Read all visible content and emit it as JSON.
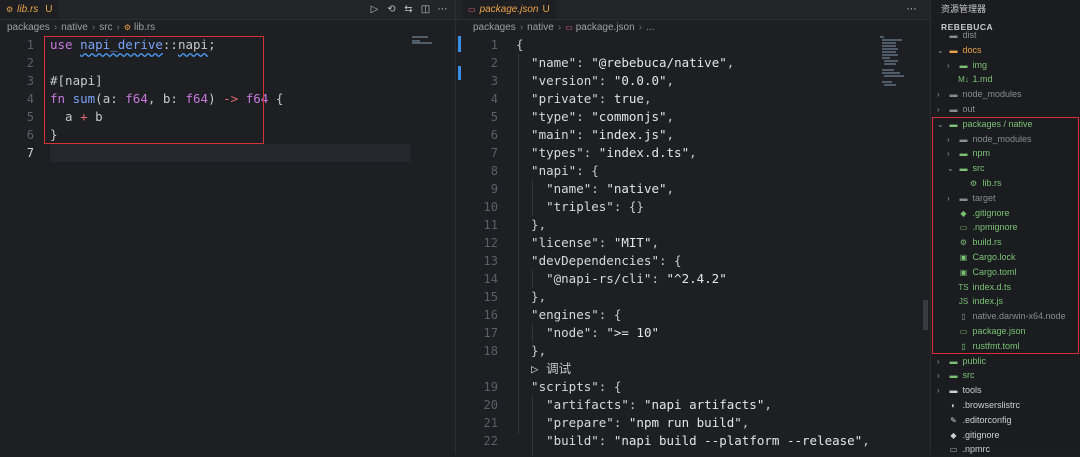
{
  "left_pane": {
    "tab": {
      "label": "lib.rs",
      "status": "U",
      "icon": "rust-file-icon"
    },
    "actions": [
      "▷",
      "⟲",
      "⇆",
      "◫",
      "⋯"
    ],
    "breadcrumbs": [
      "packages",
      "native",
      "src",
      "lib.rs"
    ],
    "lines": [
      {
        "n": "1",
        "tokens": [
          [
            "use",
            "kw"
          ],
          [
            " ",
            "p"
          ],
          [
            "napi_derive",
            "squig fn"
          ],
          [
            "::",
            "p"
          ],
          [
            "napi",
            "squig p"
          ],
          [
            ";",
            "p"
          ]
        ]
      },
      {
        "n": "2",
        "tokens": []
      },
      {
        "n": "3",
        "tokens": [
          [
            "#[napi]",
            "p"
          ]
        ]
      },
      {
        "n": "4",
        "tokens": [
          [
            "fn",
            "kw"
          ],
          [
            " ",
            "p"
          ],
          [
            "sum",
            "fn"
          ],
          [
            "(a: ",
            "p"
          ],
          [
            "f64",
            "ty"
          ],
          [
            ", b: ",
            "p"
          ],
          [
            "f64",
            "ty"
          ],
          [
            ") ",
            "p"
          ],
          [
            "->",
            "op"
          ],
          [
            " ",
            "p"
          ],
          [
            "f64",
            "ty"
          ],
          [
            " {",
            "p"
          ]
        ]
      },
      {
        "n": "5",
        "tokens": [
          [
            "  a ",
            "p"
          ],
          [
            "+",
            "op"
          ],
          [
            " b",
            "p"
          ]
        ]
      },
      {
        "n": "6",
        "tokens": [
          [
            "}",
            "p"
          ]
        ]
      },
      {
        "n": "7",
        "tokens": []
      }
    ]
  },
  "right_pane": {
    "tab": {
      "label": "package.json",
      "status": "U",
      "icon": "json-file-icon"
    },
    "actions": [
      "⋯"
    ],
    "breadcrumbs": [
      "packages",
      "native",
      "package.json",
      "..."
    ],
    "codelens": "▷ 调试",
    "lines": [
      {
        "n": "1",
        "tokens": [
          [
            "{",
            "p"
          ]
        ]
      },
      {
        "n": "2",
        "tokens": [
          [
            "  \"name\"",
            "key"
          ],
          [
            ": ",
            "p"
          ],
          [
            "\"@rebebuca/native\"",
            "str"
          ],
          [
            ",",
            "p"
          ]
        ]
      },
      {
        "n": "3",
        "tokens": [
          [
            "  \"version\"",
            "key"
          ],
          [
            ": ",
            "p"
          ],
          [
            "\"0.0.0\"",
            "str"
          ],
          [
            ",",
            "p"
          ]
        ]
      },
      {
        "n": "4",
        "tokens": [
          [
            "  \"private\"",
            "key"
          ],
          [
            ": ",
            "p"
          ],
          [
            "true",
            "str"
          ],
          [
            ",",
            "p"
          ]
        ]
      },
      {
        "n": "5",
        "tokens": [
          [
            "  \"type\"",
            "key"
          ],
          [
            ": ",
            "p"
          ],
          [
            "\"commonjs\"",
            "str"
          ],
          [
            ",",
            "p"
          ]
        ]
      },
      {
        "n": "6",
        "tokens": [
          [
            "  \"main\"",
            "key"
          ],
          [
            ": ",
            "p"
          ],
          [
            "\"index.js\"",
            "str"
          ],
          [
            ",",
            "p"
          ]
        ]
      },
      {
        "n": "7",
        "tokens": [
          [
            "  \"types\"",
            "key"
          ],
          [
            ": ",
            "p"
          ],
          [
            "\"index.d.ts\"",
            "str"
          ],
          [
            ",",
            "p"
          ]
        ]
      },
      {
        "n": "8",
        "tokens": [
          [
            "  \"napi\"",
            "key"
          ],
          [
            ": {",
            "p"
          ]
        ]
      },
      {
        "n": "9",
        "tokens": [
          [
            "    \"name\"",
            "key"
          ],
          [
            ": ",
            "p"
          ],
          [
            "\"native\"",
            "str"
          ],
          [
            ",",
            "p"
          ]
        ]
      },
      {
        "n": "10",
        "tokens": [
          [
            "    \"triples\"",
            "key"
          ],
          [
            ": {}",
            "p"
          ]
        ]
      },
      {
        "n": "11",
        "tokens": [
          [
            "  },",
            "p"
          ]
        ]
      },
      {
        "n": "12",
        "tokens": [
          [
            "  \"license\"",
            "key"
          ],
          [
            ": ",
            "p"
          ],
          [
            "\"MIT\"",
            "str"
          ],
          [
            ",",
            "p"
          ]
        ]
      },
      {
        "n": "13",
        "tokens": [
          [
            "  \"devDependencies\"",
            "key"
          ],
          [
            ": {",
            "p"
          ]
        ]
      },
      {
        "n": "14",
        "tokens": [
          [
            "    \"@napi-rs/cli\"",
            "key"
          ],
          [
            ": ",
            "p"
          ],
          [
            "\"^2.4.2\"",
            "str"
          ]
        ]
      },
      {
        "n": "15",
        "tokens": [
          [
            "  },",
            "p"
          ]
        ]
      },
      {
        "n": "16",
        "tokens": [
          [
            "  \"engines\"",
            "key"
          ],
          [
            ": {",
            "p"
          ]
        ]
      },
      {
        "n": "17",
        "tokens": [
          [
            "    \"node\"",
            "key"
          ],
          [
            ": ",
            "p"
          ],
          [
            "\">= 10\"",
            "str"
          ]
        ]
      },
      {
        "n": "18",
        "tokens": [
          [
            "  },",
            "p"
          ]
        ]
      },
      {
        "n": "",
        "tokens": [
          [
            "  ▷ 调试",
            "p"
          ]
        ]
      },
      {
        "n": "19",
        "tokens": [
          [
            "  \"scripts\"",
            "key"
          ],
          [
            ": {",
            "p"
          ]
        ]
      },
      {
        "n": "20",
        "tokens": [
          [
            "    \"artifacts\"",
            "key"
          ],
          [
            ": ",
            "p"
          ],
          [
            "\"napi artifacts\"",
            "str"
          ],
          [
            ",",
            "p"
          ]
        ]
      },
      {
        "n": "21",
        "tokens": [
          [
            "    \"prepare\"",
            "key"
          ],
          [
            ": ",
            "p"
          ],
          [
            "\"npm run build\"",
            "str"
          ],
          [
            ",",
            "p"
          ]
        ]
      },
      {
        "n": "22",
        "tokens": [
          [
            "    \"build\"",
            "key"
          ],
          [
            ": ",
            "p"
          ],
          [
            "\"napi build --platform --release\"",
            "str"
          ],
          [
            ",",
            "p"
          ]
        ]
      }
    ]
  },
  "explorer": {
    "title": "资源管理器",
    "root": "REBEBUCA",
    "items": [
      {
        "label": "dist",
        "depth": 1,
        "chev": "",
        "icon": "folder-icon",
        "glyph": "▬",
        "color": "c-grey"
      },
      {
        "label": "docs",
        "depth": 1,
        "chev": "⌄",
        "icon": "folder-open-icon",
        "glyph": "▬",
        "color": "c-orange"
      },
      {
        "label": "img",
        "depth": 2,
        "chev": "›",
        "icon": "folder-icon",
        "glyph": "▬",
        "color": "c-green"
      },
      {
        "label": "1.md",
        "depth": 2,
        "chev": "",
        "icon": "markdown-icon",
        "glyph": "M↓",
        "color": "c-green"
      },
      {
        "label": "node_modules",
        "depth": 1,
        "chev": "›",
        "icon": "folder-icon",
        "glyph": "▬",
        "color": "c-grey"
      },
      {
        "label": "out",
        "depth": 1,
        "chev": "›",
        "icon": "folder-icon",
        "glyph": "▬",
        "color": "c-grey"
      },
      {
        "label": "packages / native",
        "depth": 1,
        "chev": "⌄",
        "icon": "folder-open-icon",
        "glyph": "▬",
        "color": "c-green"
      },
      {
        "label": "node_modules",
        "depth": 2,
        "chev": "›",
        "icon": "folder-icon",
        "glyph": "▬",
        "color": "c-grey"
      },
      {
        "label": "npm",
        "depth": 2,
        "chev": "›",
        "icon": "folder-icon",
        "glyph": "▬",
        "color": "c-green"
      },
      {
        "label": "src",
        "depth": 2,
        "chev": "⌄",
        "icon": "folder-open-icon",
        "glyph": "▬",
        "color": "c-green"
      },
      {
        "label": "lib.rs",
        "depth": 3,
        "chev": "",
        "icon": "rust-file-icon",
        "glyph": "⚙",
        "color": "c-green"
      },
      {
        "label": "target",
        "depth": 2,
        "chev": "›",
        "icon": "folder-icon",
        "glyph": "▬",
        "color": "c-grey"
      },
      {
        "label": ".gitignore",
        "depth": 2,
        "chev": "",
        "icon": "git-icon",
        "glyph": "◆",
        "color": "c-green"
      },
      {
        "label": ".npmignore",
        "depth": 2,
        "chev": "",
        "icon": "npm-icon",
        "glyph": "▭",
        "color": "c-green"
      },
      {
        "label": "build.rs",
        "depth": 2,
        "chev": "",
        "icon": "rust-file-icon",
        "glyph": "⚙",
        "color": "c-green"
      },
      {
        "label": "Cargo.lock",
        "depth": 2,
        "chev": "",
        "icon": "cargo-icon",
        "glyph": "▣",
        "color": "c-green"
      },
      {
        "label": "Cargo.toml",
        "depth": 2,
        "chev": "",
        "icon": "cargo-icon",
        "glyph": "▣",
        "color": "c-green"
      },
      {
        "label": "index.d.ts",
        "depth": 2,
        "chev": "",
        "icon": "typescript-icon",
        "glyph": "TS",
        "color": "c-green"
      },
      {
        "label": "index.js",
        "depth": 2,
        "chev": "",
        "icon": "javascript-icon",
        "glyph": "JS",
        "color": "c-green"
      },
      {
        "label": "native.darwin-x64.node",
        "depth": 2,
        "chev": "",
        "icon": "file-icon",
        "glyph": "▯",
        "color": "c-grey"
      },
      {
        "label": "package.json",
        "depth": 2,
        "chev": "",
        "icon": "json-file-icon",
        "glyph": "▭",
        "color": "c-green"
      },
      {
        "label": "rustfmt.toml",
        "depth": 2,
        "chev": "",
        "icon": "toml-file-icon",
        "glyph": "▯",
        "color": "c-green"
      },
      {
        "label": "public",
        "depth": 1,
        "chev": "›",
        "icon": "folder-icon",
        "glyph": "▬",
        "color": "c-green"
      },
      {
        "label": "src",
        "depth": 1,
        "chev": "›",
        "icon": "folder-icon",
        "glyph": "▬",
        "color": "c-green"
      },
      {
        "label": "tools",
        "depth": 1,
        "chev": "›",
        "icon": "folder-icon",
        "glyph": "▬",
        "color": "c-white"
      },
      {
        "label": ".browserslistrc",
        "depth": 1,
        "chev": "",
        "icon": "browserslist-icon",
        "glyph": "◐",
        "color": "c-white"
      },
      {
        "label": ".editorconfig",
        "depth": 1,
        "chev": "",
        "icon": "editorconfig-icon",
        "glyph": "✎",
        "color": "c-white"
      },
      {
        "label": ".gitignore",
        "depth": 1,
        "chev": "",
        "icon": "git-icon",
        "glyph": "◆",
        "color": "c-white"
      },
      {
        "label": ".npmrc",
        "depth": 1,
        "chev": "",
        "icon": "npm-icon",
        "glyph": "▭",
        "color": "c-white"
      }
    ]
  },
  "colors": {
    "highlight_box": "#d6303a",
    "accent": "#e8a34a"
  }
}
